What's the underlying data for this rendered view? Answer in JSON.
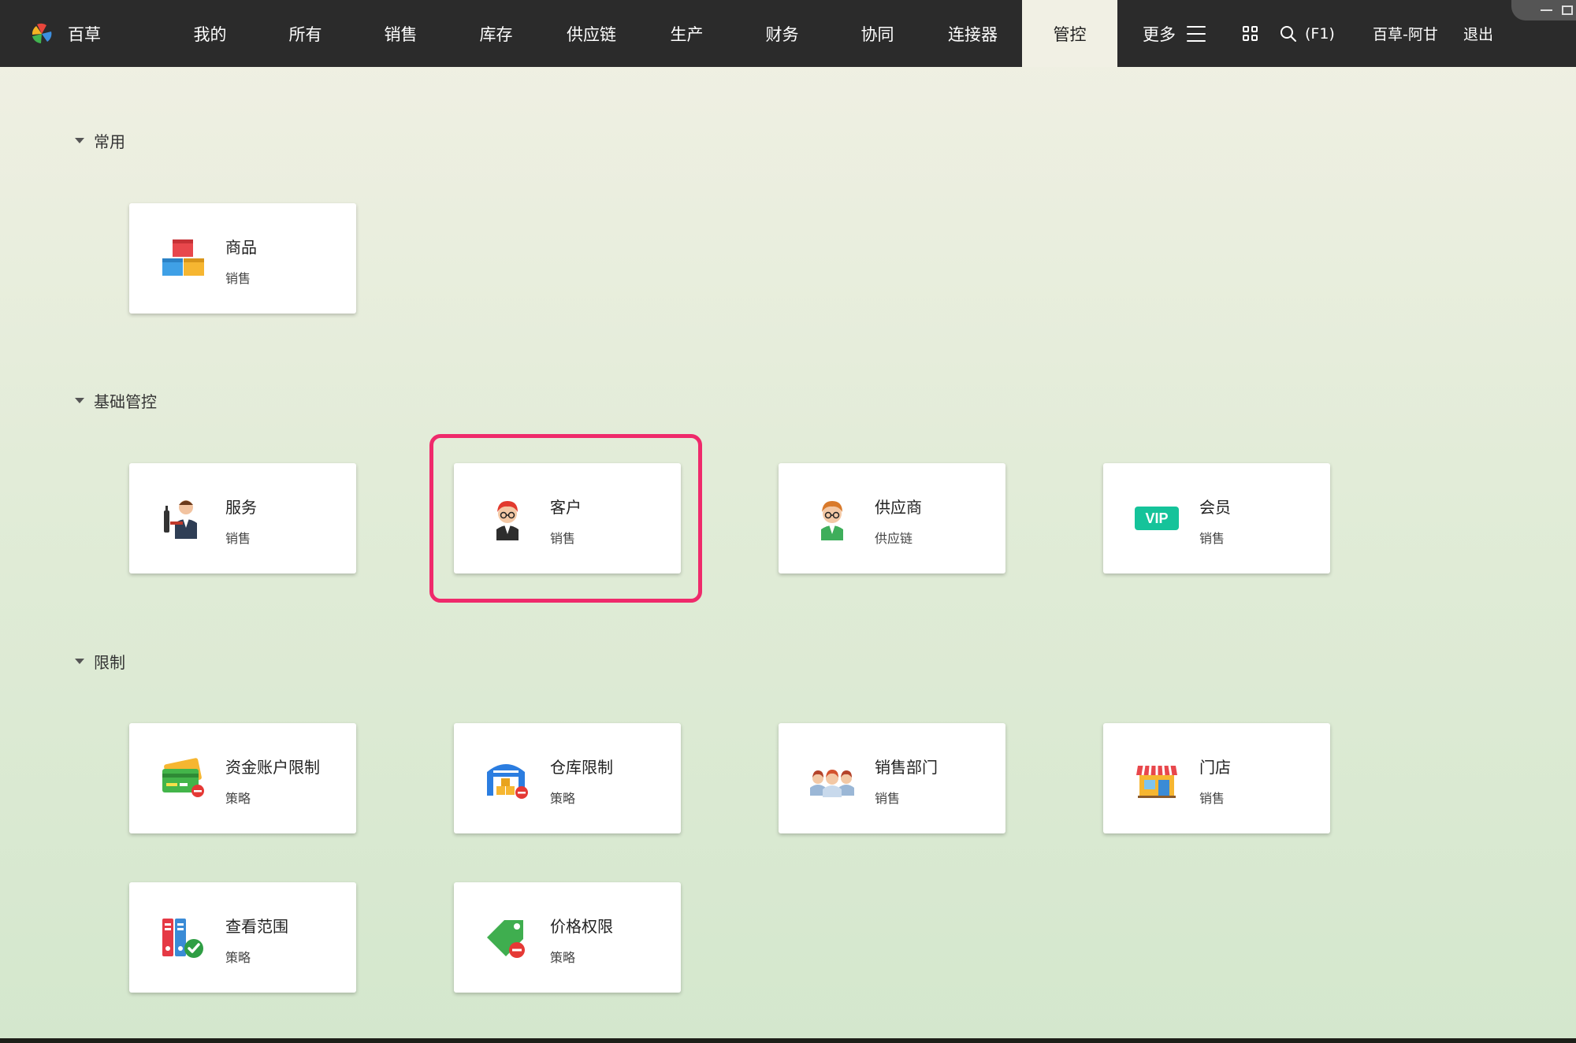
{
  "app": {
    "brand": "百草"
  },
  "nav": [
    {
      "label": "我的",
      "active": false
    },
    {
      "label": "所有",
      "active": false
    },
    {
      "label": "销售",
      "active": false
    },
    {
      "label": "库存",
      "active": false
    },
    {
      "label": "供应链",
      "active": false
    },
    {
      "label": "生产",
      "active": false
    },
    {
      "label": "财务",
      "active": false
    },
    {
      "label": "协同",
      "active": false
    },
    {
      "label": "连接器",
      "active": false
    },
    {
      "label": "管控",
      "active": true
    }
  ],
  "header": {
    "more_label": "更多",
    "search_hint": "(F1)",
    "user": "百草-阿甘",
    "logout": "退出"
  },
  "sections": [
    {
      "title": "常用",
      "cards": [
        {
          "title": "商品",
          "sub": "销售",
          "icon": "goods-boxes-icon"
        }
      ]
    },
    {
      "title": "基础管控",
      "cards": [
        {
          "title": "服务",
          "sub": "销售",
          "icon": "waiter-service-icon"
        },
        {
          "title": "客户",
          "sub": "销售",
          "icon": "customer-avatar-icon",
          "highlighted": true
        },
        {
          "title": "供应商",
          "sub": "供应链",
          "icon": "supplier-avatar-icon"
        },
        {
          "title": "会员",
          "sub": "销售",
          "icon": "vip-badge-icon"
        }
      ]
    },
    {
      "title": "限制",
      "cards": [
        {
          "title": "资金账户限制",
          "sub": "策略",
          "icon": "credit-card-restrict-icon"
        },
        {
          "title": "仓库限制",
          "sub": "策略",
          "icon": "warehouse-restrict-icon"
        },
        {
          "title": "销售部门",
          "sub": "销售",
          "icon": "sales-team-icon"
        },
        {
          "title": "门店",
          "sub": "销售",
          "icon": "store-icon"
        },
        {
          "title": "查看范围",
          "sub": "策略",
          "icon": "binders-check-icon"
        },
        {
          "title": "价格权限",
          "sub": "策略",
          "icon": "price-tag-restrict-icon"
        }
      ]
    }
  ],
  "vip_text": "VIP",
  "colors": {
    "topbar": "#2b2b2b",
    "highlight": "#ef2a6b",
    "vip": "#15c39a"
  }
}
